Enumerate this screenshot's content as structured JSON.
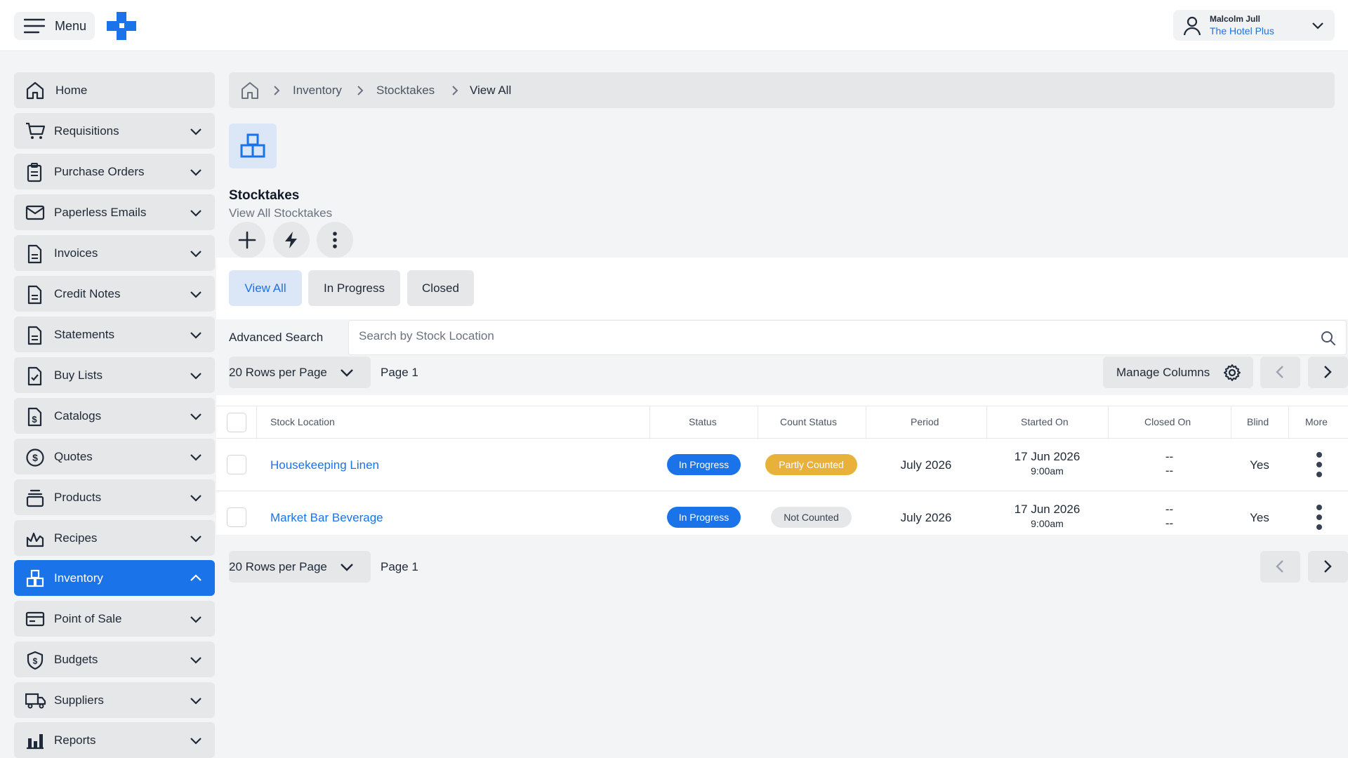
{
  "header": {
    "menu_label": "Menu",
    "user_name": "Malcolm Jull",
    "user_org": "The Hotel Plus"
  },
  "sidebar": {
    "items": [
      {
        "label": "Home",
        "icon": "home-icon"
      },
      {
        "label": "Requisitions",
        "icon": "cart-icon"
      },
      {
        "label": "Purchase Orders",
        "icon": "clipboard-icon"
      },
      {
        "label": "Paperless Emails",
        "icon": "envelope-icon"
      },
      {
        "label": "Invoices",
        "icon": "document-icon"
      },
      {
        "label": "Credit Notes",
        "icon": "document-icon"
      },
      {
        "label": "Statements",
        "icon": "document-icon"
      },
      {
        "label": "Buy Lists",
        "icon": "checklist-icon"
      },
      {
        "label": "Catalogs",
        "icon": "dollar-document-icon"
      },
      {
        "label": "Quotes",
        "icon": "dollar-circle-icon"
      },
      {
        "label": "Products",
        "icon": "stack-icon"
      },
      {
        "label": "Recipes",
        "icon": "chef-icon"
      },
      {
        "label": "Inventory",
        "icon": "boxes-icon",
        "active": true
      },
      {
        "label": "Point of Sale",
        "icon": "card-icon"
      },
      {
        "label": "Budgets",
        "icon": "shield-dollar-icon"
      },
      {
        "label": "Suppliers",
        "icon": "truck-icon"
      },
      {
        "label": "Reports",
        "icon": "bar-chart-icon"
      }
    ]
  },
  "breadcrumb": {
    "items": [
      "Inventory",
      "Stocktakes",
      "View All"
    ]
  },
  "page": {
    "title": "Stocktakes",
    "subtitle": "View All Stocktakes"
  },
  "tabs": [
    "View All",
    "In Progress",
    "Closed"
  ],
  "search": {
    "advanced_label": "Advanced Search",
    "placeholder": "Search by Stock Location"
  },
  "controls": {
    "rows_per_page": "20 Rows per Page",
    "page_label": "Page 1",
    "manage_columns": "Manage Columns"
  },
  "table": {
    "columns": [
      "Stock Location",
      "Status",
      "Count Status",
      "Period",
      "Started On",
      "Closed On",
      "Blind",
      "More"
    ],
    "rows": [
      {
        "stock_location": "Housekeeping Linen",
        "status": "In Progress",
        "count_status": "Partly Counted",
        "period": "July 2026",
        "started_date": "17 Jun 2026",
        "started_time": "9:00am",
        "closed_date": "--",
        "closed_time": "--",
        "blind": "Yes"
      },
      {
        "stock_location": "Market Bar Beverage",
        "status": "In Progress",
        "count_status": "Not Counted",
        "period": "July 2026",
        "started_date": "17 Jun 2026",
        "started_time": "9:00am",
        "closed_date": "--",
        "closed_time": "--",
        "blind": "Yes"
      }
    ]
  },
  "colors": {
    "accent": "#1a73e8",
    "partly_counted": "#e8b23a",
    "not_counted": "#e6e7e9"
  }
}
